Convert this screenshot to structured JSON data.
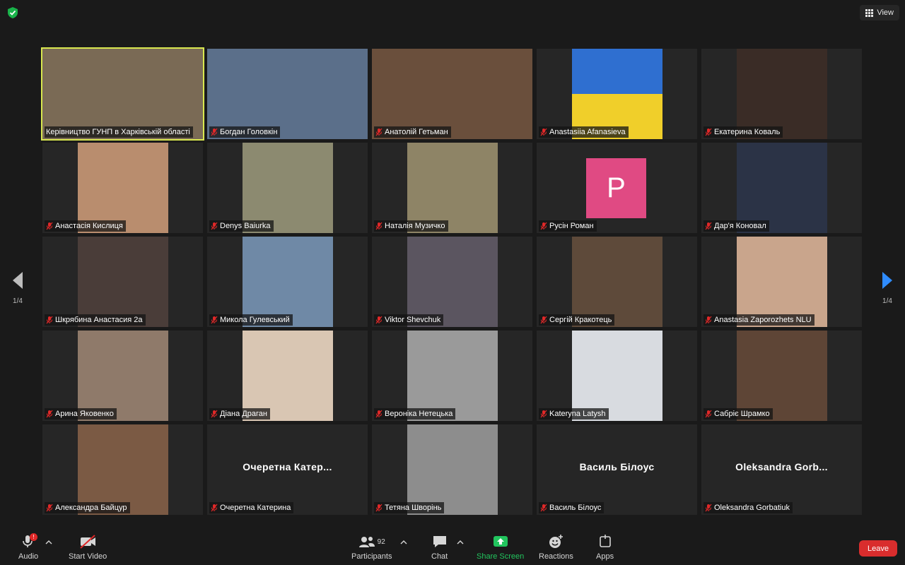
{
  "topbar": {
    "view_label": "View"
  },
  "pagination": {
    "left": "1/4",
    "right": "1/4"
  },
  "participants": [
    {
      "name": "Керівництво ГУНП в Харківській області",
      "type": "video",
      "bg": "#7a6a55",
      "active": true,
      "muted": false
    },
    {
      "name": "Богдан Головкін",
      "type": "video",
      "bg": "#5b6f8a",
      "muted": true
    },
    {
      "name": "Анатолій Гетьман",
      "type": "video",
      "bg": "#6a4f3c",
      "muted": true
    },
    {
      "name": "Anastasiia Afanasieva",
      "type": "photo",
      "bg": "#2f6fd0",
      "bg2": "#f0cf2a",
      "muted": true
    },
    {
      "name": "Екатерина Коваль",
      "type": "photo",
      "bg": "#3a2c26",
      "muted": true
    },
    {
      "name": "Анастасія Кислиця",
      "type": "photo",
      "bg": "#b98d6e",
      "muted": true
    },
    {
      "name": "Denys Baiurka",
      "type": "photo",
      "bg": "#8c8a70",
      "muted": true
    },
    {
      "name": "Наталія Музичко",
      "type": "photo",
      "bg": "#8e8466",
      "muted": true
    },
    {
      "name": "Русін Роман",
      "type": "initial",
      "initial": "P",
      "muted": true
    },
    {
      "name": "Дар'я Коновал",
      "type": "photo",
      "bg": "#2b3346",
      "muted": true
    },
    {
      "name": "Шкрябина Анастасия 2а",
      "type": "photo",
      "bg": "#4a3d39",
      "muted": true
    },
    {
      "name": "Микола Гулевський",
      "type": "photo",
      "bg": "#6f89a6",
      "muted": true
    },
    {
      "name": "Viktor Shevchuk",
      "type": "photo",
      "bg": "#5b5560",
      "muted": true
    },
    {
      "name": "Сергій Кракотець",
      "type": "photo",
      "bg": "#5e4a3a",
      "muted": true
    },
    {
      "name": "Anastasia Zaporozhets NLU",
      "type": "photo",
      "bg": "#c9a58c",
      "muted": true
    },
    {
      "name": "Арина Яковенко",
      "type": "photo",
      "bg": "#8f7a6a",
      "muted": true
    },
    {
      "name": "Діана Драган",
      "type": "photo",
      "bg": "#d9c6b3",
      "muted": true
    },
    {
      "name": "Вероніка Нетецька",
      "type": "photo",
      "bg": "#9a9a9a",
      "muted": true
    },
    {
      "name": "Kateryna Latysh",
      "type": "photo",
      "bg": "#d8dbe0",
      "muted": true
    },
    {
      "name": "Сабріє Шрамко",
      "type": "photo",
      "bg": "#5e4536",
      "muted": true
    },
    {
      "name": "Александра Байцур",
      "type": "photo",
      "bg": "#7b5a44",
      "muted": true
    },
    {
      "name": "Очеретна Катерина",
      "type": "name",
      "big": "Очеретна  Катер...",
      "muted": true
    },
    {
      "name": "Тетяна Шворінь",
      "type": "photo",
      "bg": "#8d8d8d",
      "muted": true
    },
    {
      "name": "Василь Білоус",
      "type": "name",
      "big": "Василь Білоус",
      "muted": true
    },
    {
      "name": "Oleksandra Gorbatiuk",
      "type": "name",
      "big": "Oleksandra  Gorb...",
      "muted": true
    }
  ],
  "toolbar": {
    "audio": "Audio",
    "audio_badge": "!",
    "video": "Start Video",
    "participants": "Participants",
    "participants_count": "92",
    "chat": "Chat",
    "share": "Share Screen",
    "reactions": "Reactions",
    "apps": "Apps",
    "leave": "Leave"
  },
  "colors": {
    "accent": "#2f8cff",
    "share": "#22c55e",
    "leave": "#d92d2d",
    "active": "#d9e84f"
  }
}
